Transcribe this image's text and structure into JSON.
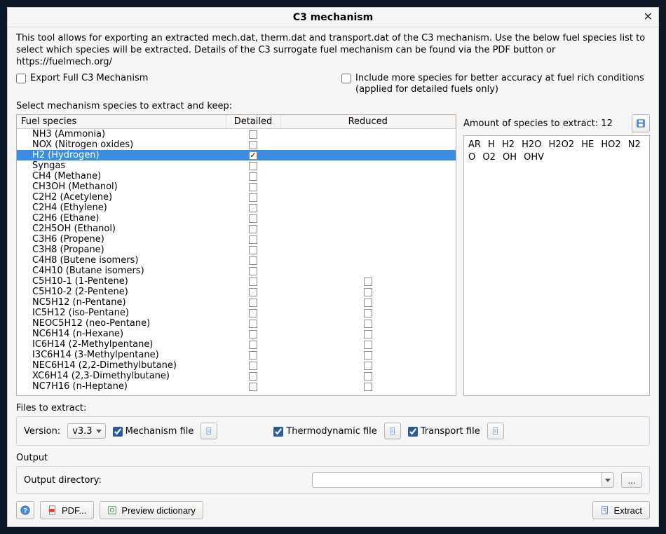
{
  "window": {
    "title": "C3 mechanism"
  },
  "intro": "This tool allows for exporting an extracted mech.dat, therm.dat and transport.dat of the C3 mechanism. Use the below fuel species list to select which species will be extracted. Details of the C3 surrogate fuel mechanism can be found via the PDF button or https://fuelmech.org/",
  "options": {
    "export_full_label": "Export Full C3 Mechanism",
    "include_more_label": "Include more species for better accuracy at fuel rich conditions (applied for detailed fuels only)"
  },
  "select_label": "Select mechanism species to extract and keep:",
  "columns": {
    "name": "Fuel species",
    "detailed": "Detailed",
    "reduced": "Reduced"
  },
  "species": [
    {
      "name": "NH3 (Ammonia)",
      "detailed": false,
      "reduced": null,
      "selected": false
    },
    {
      "name": "NOX (Nitrogen oxides)",
      "detailed": false,
      "reduced": null,
      "selected": false
    },
    {
      "name": "H2 (Hydrogen)",
      "detailed": true,
      "reduced": null,
      "selected": true
    },
    {
      "name": "Syngas",
      "detailed": false,
      "reduced": null,
      "selected": false
    },
    {
      "name": "CH4 (Methane)",
      "detailed": false,
      "reduced": null,
      "selected": false
    },
    {
      "name": "CH3OH (Methanol)",
      "detailed": false,
      "reduced": null,
      "selected": false
    },
    {
      "name": "C2H2 (Acetylene)",
      "detailed": false,
      "reduced": null,
      "selected": false
    },
    {
      "name": "C2H4 (Ethylene)",
      "detailed": false,
      "reduced": null,
      "selected": false
    },
    {
      "name": "C2H6 (Ethane)",
      "detailed": false,
      "reduced": null,
      "selected": false
    },
    {
      "name": "C2H5OH (Ethanol)",
      "detailed": false,
      "reduced": null,
      "selected": false
    },
    {
      "name": "C3H6 (Propene)",
      "detailed": false,
      "reduced": null,
      "selected": false
    },
    {
      "name": "C3H8 (Propane)",
      "detailed": false,
      "reduced": null,
      "selected": false
    },
    {
      "name": "C4H8 (Butene isomers)",
      "detailed": false,
      "reduced": null,
      "selected": false
    },
    {
      "name": "C4H10 (Butane isomers)",
      "detailed": false,
      "reduced": null,
      "selected": false
    },
    {
      "name": "C5H10-1 (1-Pentene)",
      "detailed": false,
      "reduced": false,
      "selected": false
    },
    {
      "name": "C5H10-2 (2-Pentene)",
      "detailed": false,
      "reduced": false,
      "selected": false
    },
    {
      "name": "NC5H12 (n-Pentane)",
      "detailed": false,
      "reduced": false,
      "selected": false
    },
    {
      "name": "IC5H12 (iso-Pentane)",
      "detailed": false,
      "reduced": false,
      "selected": false
    },
    {
      "name": "NEOC5H12 (neo-Pentane)",
      "detailed": false,
      "reduced": false,
      "selected": false
    },
    {
      "name": "NC6H14 (n-Hexane)",
      "detailed": false,
      "reduced": false,
      "selected": false
    },
    {
      "name": "IC6H14 (2-Methylpentane)",
      "detailed": false,
      "reduced": false,
      "selected": false
    },
    {
      "name": "I3C6H14 (3-Methylpentane)",
      "detailed": false,
      "reduced": false,
      "selected": false
    },
    {
      "name": "NEC6H14 (2,2-Dimethylbutane)",
      "detailed": false,
      "reduced": false,
      "selected": false
    },
    {
      "name": "XC6H14 (2,3-Dimethylbutane)",
      "detailed": false,
      "reduced": false,
      "selected": false
    },
    {
      "name": "NC7H16 (n-Heptane)",
      "detailed": false,
      "reduced": false,
      "selected": false
    }
  ],
  "amount_label_prefix": "Amount of species to extract: ",
  "amount_value": "12",
  "extracted_species": "AR  H  H2  H2O  H2O2  HE  HO2  N2  O  O2  OH  OHV",
  "files": {
    "section_label": "Files to extract:",
    "version_label": "Version:",
    "version_value": "v3.3",
    "mechanism_label": "Mechanism file",
    "thermo_label": "Thermodynamic file",
    "transport_label": "Transport file"
  },
  "output": {
    "section_label": "Output",
    "dir_label": "Output directory:",
    "dir_value": "",
    "browse_label": "..."
  },
  "footer": {
    "pdf_label": "PDF...",
    "preview_label": "Preview dictionary",
    "extract_label": "Extract"
  }
}
